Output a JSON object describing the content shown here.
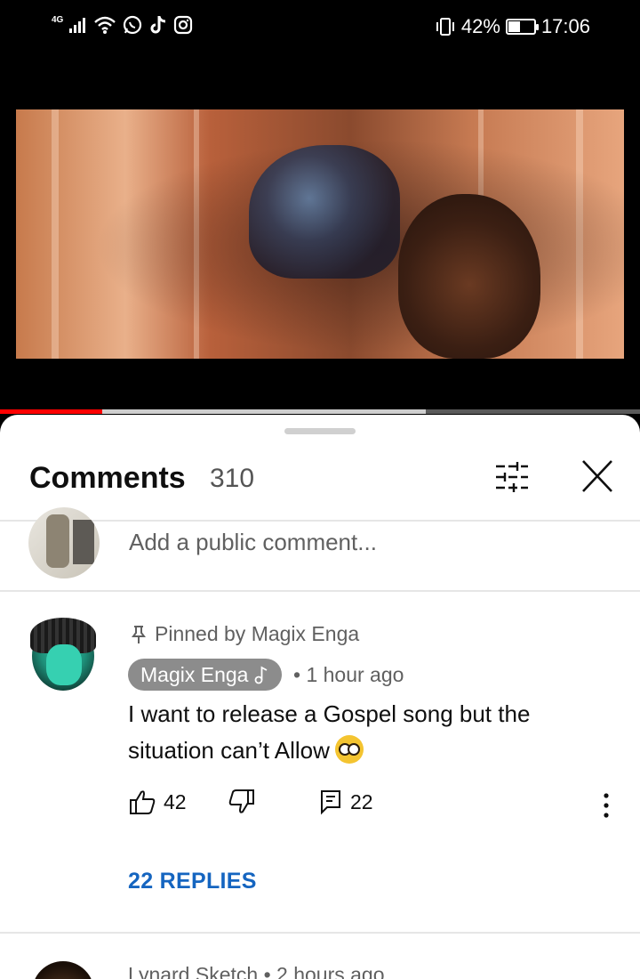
{
  "status_bar": {
    "network": "4G",
    "battery": "42%",
    "battery_level": 0.42,
    "time": "17:06",
    "icons": [
      "signal-icon",
      "wifi-icon",
      "whatsapp-icon",
      "tiktok-icon",
      "instagram-icon",
      "vibrate-icon"
    ]
  },
  "video": {
    "progress_played": 0.16,
    "progress_buffered": 0.665
  },
  "comments_panel": {
    "title": "Comments",
    "count": "310",
    "add_comment_placeholder": "Add a public comment...",
    "pinned_comment": {
      "pinned_label": "Pinned by Magix Enga",
      "author": "Magix Enga",
      "time": "• 1 hour ago",
      "text": "I want to release a Gospel song but the situation can’t Allow",
      "likes": "42",
      "reply_count": "22",
      "replies_link": "22 REPLIES"
    },
    "next_comment": {
      "meta": "Lynard Sketch • 2 hours ago"
    }
  }
}
